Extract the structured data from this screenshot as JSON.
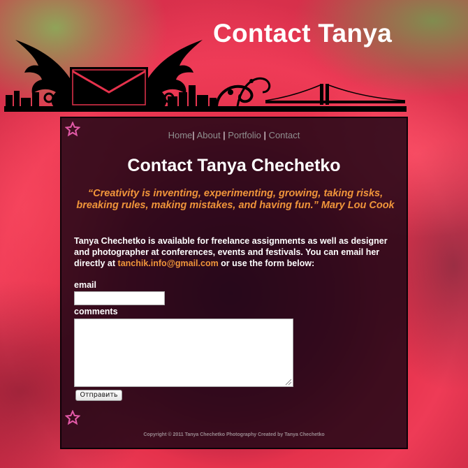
{
  "site": {
    "title": "Contact Tanya"
  },
  "nav": {
    "items": [
      {
        "label": "Home"
      },
      {
        "label": "About"
      },
      {
        "label": "Portfolio"
      },
      {
        "label": "Contact"
      }
    ],
    "separator": "|"
  },
  "main": {
    "heading": "Contact Tanya Chechetko",
    "quote": "“Creativity is inventing, experimenting, growing, taking risks, breaking rules, making mistakes, and having fun.” Mary Lou Cook",
    "intro_text": "Tanya Chechetko is available for freelance assignments as well as designer and photographer at conferences, events and festivals. You can email her directly at",
    "email_link": "tanchik.info@gmail.com",
    "intro_suffix": " or use the form below:"
  },
  "form": {
    "email_label": "email",
    "email_value": "",
    "comments_label": "comments",
    "comments_value": "",
    "submit_label": "Отправить"
  },
  "footer": {
    "text": "Copyright © 2011 Tanya Chechetko Photography Created by Tanya Chechetko"
  },
  "colors": {
    "accent": "#f0953a",
    "panel_bg": "#1e0616",
    "nav_link": "#8f8f8f",
    "star": "#e35aa8",
    "rose": "#e5324c"
  },
  "icons": {
    "banner": "envelope-wings-skyline-icon",
    "star": "star-outline-icon",
    "resize": "resize-grip-icon"
  }
}
